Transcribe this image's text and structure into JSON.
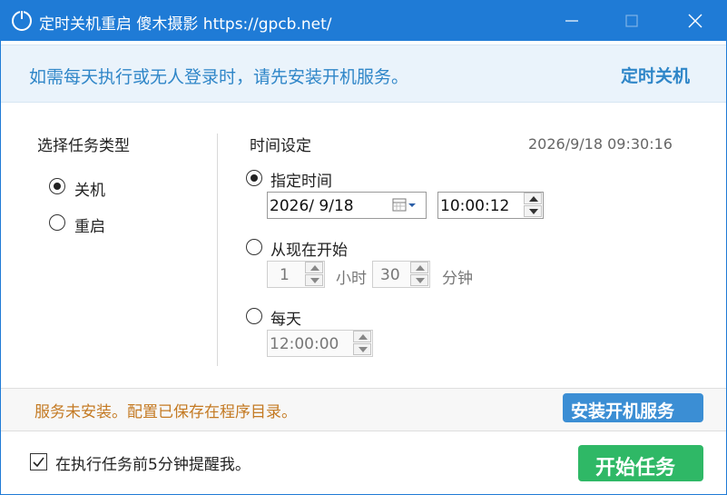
{
  "window": {
    "title": "定时关机重启  傻木摄影  https://gpcb.net/",
    "minimize_icon": "minimize-icon",
    "maximize_icon": "maximize-icon",
    "close_icon": "close-icon"
  },
  "banner": {
    "message": "如需每天执行或无人登录时，请先安装开机服务。",
    "title": "定时关机"
  },
  "task_type": {
    "heading": "选择任务类型",
    "options": [
      {
        "label": "关机",
        "checked": true
      },
      {
        "label": "重启",
        "checked": false
      }
    ]
  },
  "time_settings": {
    "heading": "时间设定",
    "current_time": "2026/9/18 09:30:16",
    "specified": {
      "label": "指定时间",
      "checked": true,
      "date_value": "2026/  9/18",
      "time_value": "10:00:12"
    },
    "from_now": {
      "label": "从现在开始",
      "checked": false,
      "hours_value": "1",
      "hours_unit": "小时",
      "minutes_value": "30",
      "minutes_unit": "分钟"
    },
    "daily": {
      "label": "每天",
      "checked": false,
      "time_value": "12:00:00"
    }
  },
  "status": {
    "message": "服务未安装。配置已保存在程序目录。",
    "install_button": "安装开机服务"
  },
  "footer": {
    "remind_label": "在执行任务前5分钟提醒我。",
    "remind_checked": true,
    "start_button": "开始任务"
  },
  "colors": {
    "titlebar": "#1f7bd6",
    "banner_text": "#2f86c8",
    "status_text": "#c47a23",
    "install_button": "#3b8ed4",
    "start_button": "#2fb866"
  }
}
